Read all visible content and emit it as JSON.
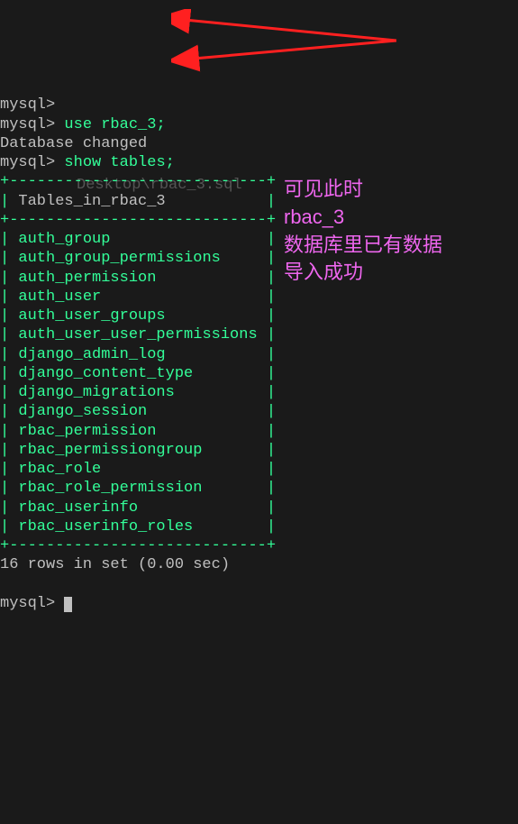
{
  "prompt_text": "mysql>",
  "cmd1": "use rbac_3;",
  "response1": "Database changed",
  "cmd2": "show tables;",
  "border_top": "+----------------------------+",
  "header_left": "| ",
  "header_label": "Tables_in_rbac_3",
  "header_right": "           |",
  "border_mid": "+----------------------------+",
  "tables": [
    "auth_group",
    "auth_group_permissions",
    "auth_permission",
    "auth_user",
    "auth_user_groups",
    "auth_user_user_permissions",
    "django_admin_log",
    "django_content_type",
    "django_migrations",
    "django_session",
    "rbac_permission",
    "rbac_permissiongroup",
    "rbac_role",
    "rbac_role_permission",
    "rbac_userinfo",
    "rbac_userinfo_roles"
  ],
  "paddings": [
    "                 |",
    "     |",
    "            |",
    "                  |",
    "           |",
    " |",
    "           |",
    "        |",
    "          |",
    "             |",
    "            |",
    "       |",
    "                  |",
    "       |",
    "              |",
    "        |"
  ],
  "border_bot": "+----------------------------+",
  "result_text": "16 rows in set (0.00 sec)",
  "faded_text": "Desktop\\rbac_3.sql",
  "annotation_lines": {
    "l1": "可见此时",
    "l2": "rbac_3",
    "l3": "数据库里已有数据",
    "l4": "导入成功"
  }
}
